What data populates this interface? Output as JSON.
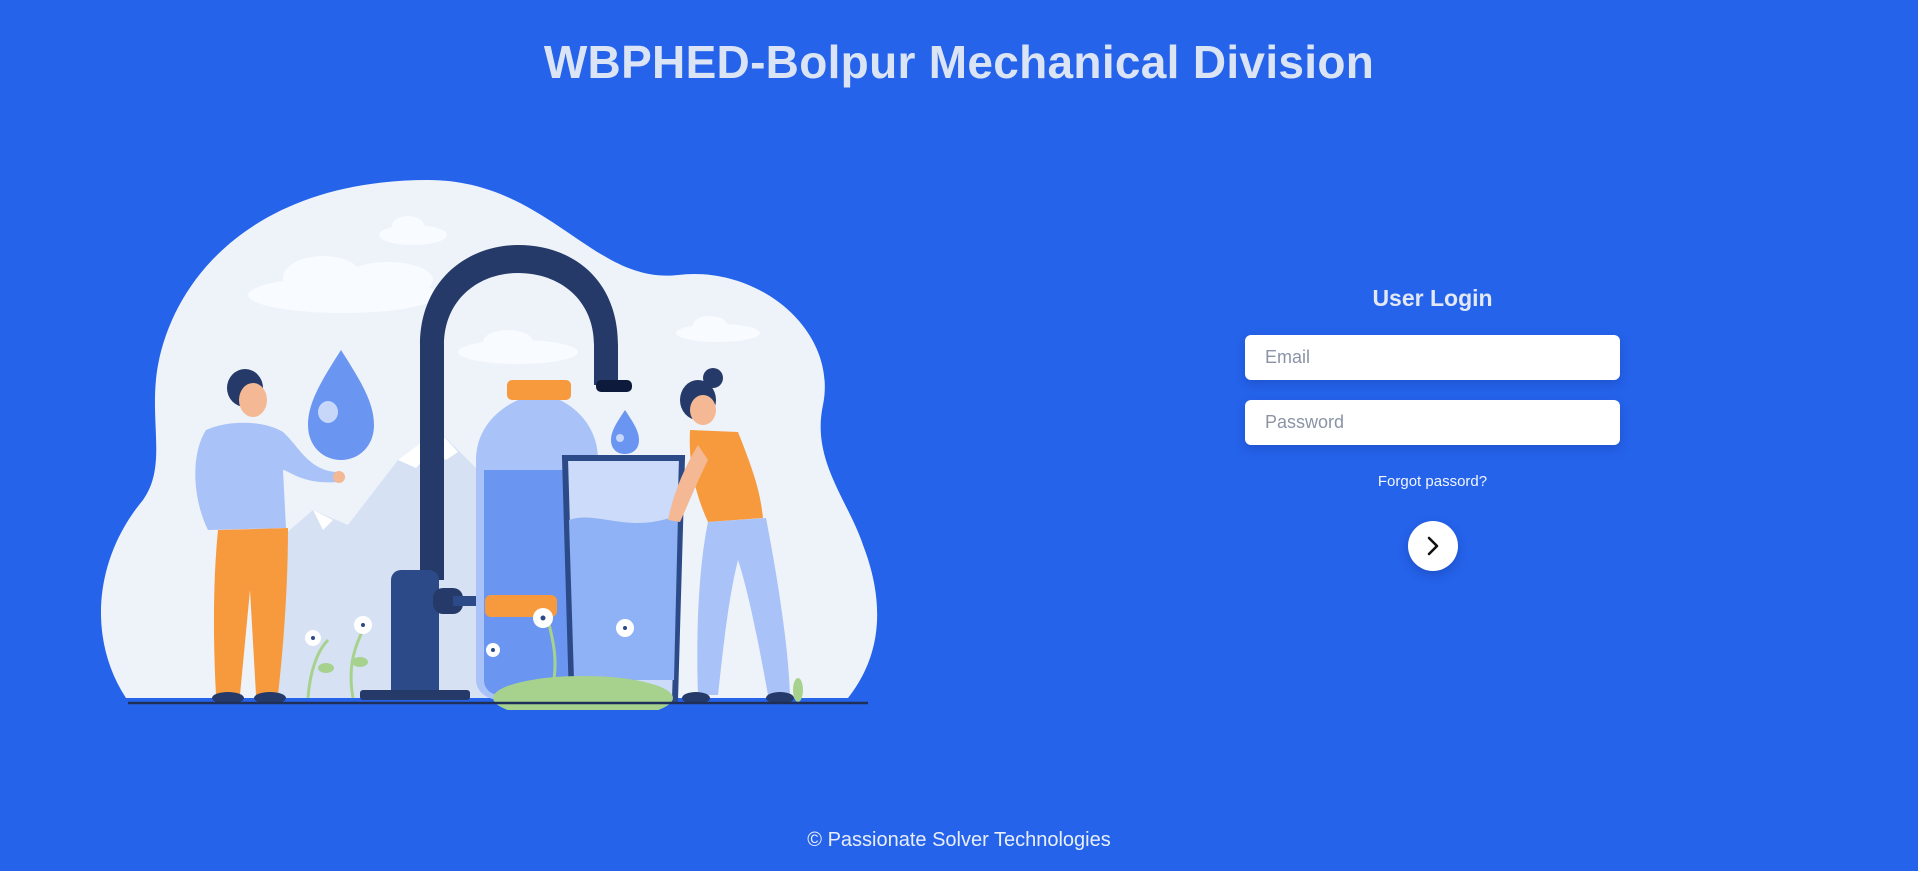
{
  "header": {
    "title": "WBPHED-Bolpur Mechanical Division"
  },
  "illustration": {
    "subject": "water-tap-illustration"
  },
  "login": {
    "title": "User Login",
    "email_placeholder": "Email",
    "email_value": "",
    "password_placeholder": "Password",
    "password_value": "",
    "forgot_label": "Forgot passord?",
    "submit_icon": "chevron-right-icon"
  },
  "footer": {
    "copyright": "© Passionate Solver Technologies"
  },
  "colors": {
    "background": "#2563eb",
    "card": "#ffffff",
    "illustration_blob": "#eef3fa",
    "tap": "#253a68",
    "accent_orange": "#f79a3e"
  }
}
